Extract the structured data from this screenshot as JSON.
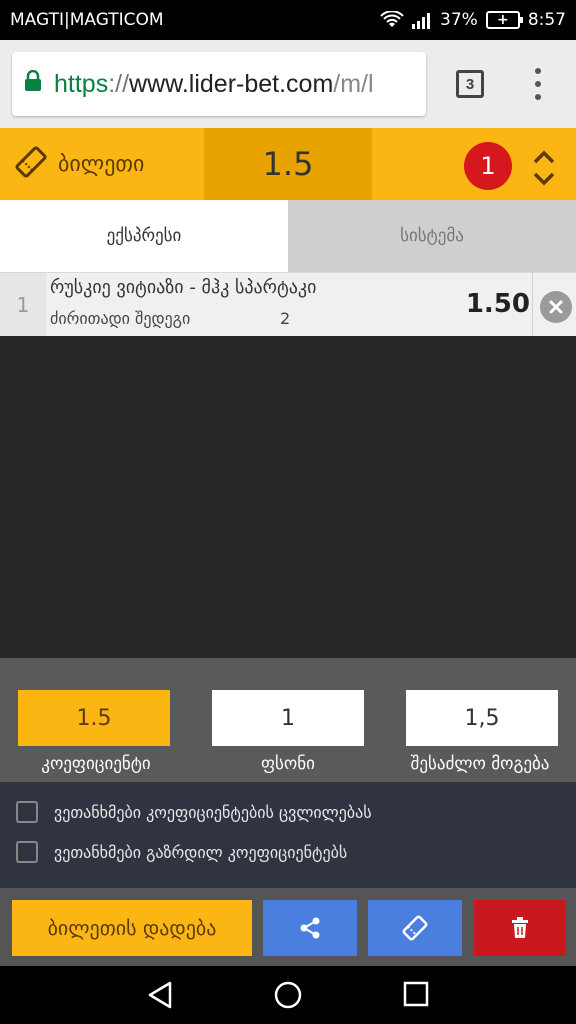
{
  "status_bar": {
    "carrier": "MAGTI|MAGTICOM",
    "battery": "37%",
    "time": "8:57"
  },
  "browser": {
    "url_scheme": "https",
    "url_sep": "://",
    "url_host": "www.lider-bet.com",
    "url_path": "/m/l",
    "tab_count": "3"
  },
  "ticket": {
    "title": "ბილეთი",
    "total_odds": "1.5",
    "bet_count": "1"
  },
  "tabs": [
    {
      "label": "ექსპრესი",
      "active": true
    },
    {
      "label": "სისტემა",
      "active": false
    }
  ],
  "bets": [
    {
      "index": "1",
      "match": "რუსკიე ვიტიაზი - მჰკ სპარტაკი",
      "market": "ძირითადი შედეგი",
      "pick": "2",
      "odds": "1.50"
    }
  ],
  "summary": {
    "odds_value": "1.5",
    "odds_label": "კოეფიციენტი",
    "stake_value": "1",
    "stake_label": "ფსონი",
    "win_value": "1,5",
    "win_label": "შესაძლო მოგება"
  },
  "options": [
    {
      "label": "ვეთანხმები კოეფიციენტების ცვლილებას",
      "checked": false
    },
    {
      "label": "ვეთანხმები გაზრდილ კოეფიციენტებს",
      "checked": false
    }
  ],
  "actions": {
    "place_label": "ბილეთის დადება"
  },
  "colors": {
    "accent": "#fcb614",
    "accent_dark": "#e8a300",
    "blue": "#4a7fe0",
    "red": "#c9181e",
    "badge_red": "#d6171d"
  }
}
